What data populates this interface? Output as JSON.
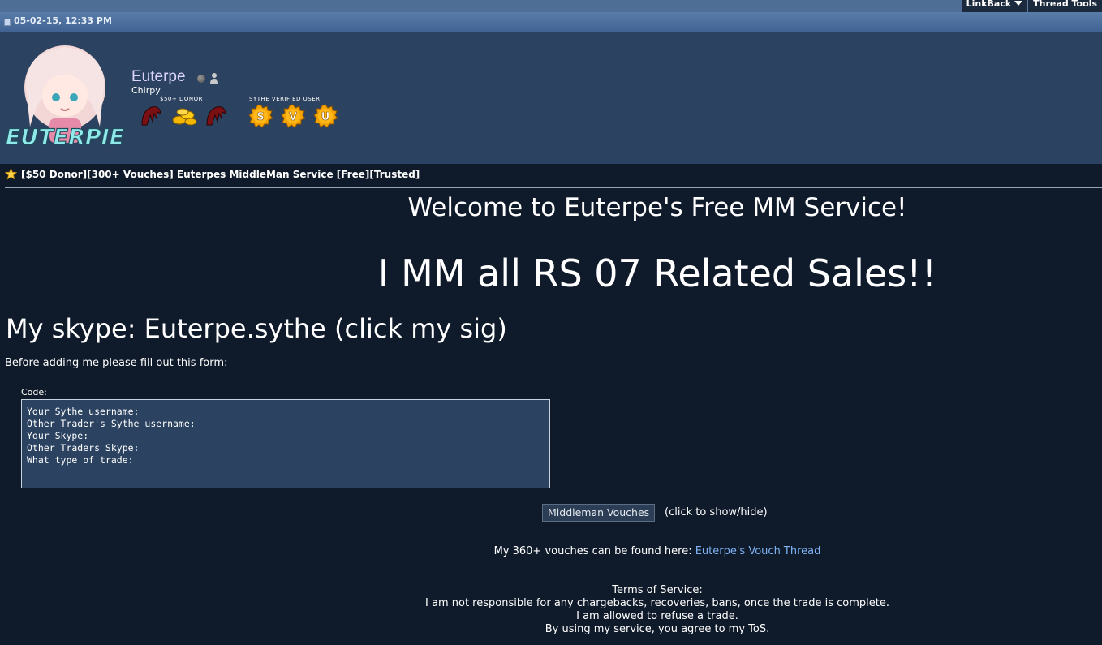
{
  "toolbar": {
    "linkback": "LinkBack",
    "thread_tools": "Thread Tools"
  },
  "post": {
    "date": "05-02-15, 12:33 PM"
  },
  "user": {
    "name": "Euterpe",
    "title": "Chirpy",
    "avatar_text": "EUTERPIE",
    "award_groups": [
      {
        "label": "$50+ DONOR"
      },
      {
        "label": "SYTHE VERIFIED USER",
        "letters": [
          "S",
          "V",
          "U"
        ]
      }
    ]
  },
  "thread": {
    "title": "[$50 Donor][300+ Vouches] Euterpes MiddleMan Service [Free][Trusted]"
  },
  "content": {
    "welcome": "Welcome to Euterpe's Free MM Service!",
    "mm_all": "I MM all RS 07 Related Sales!!",
    "skype": "My skype: Euterpe.sythe (click my sig)",
    "form_intro": "Before adding me please fill out this form:",
    "code_label": "Code:",
    "code_lines": "Your Sythe username:\nOther Trader's Sythe username:\nYour Skype:\nOther Traders Skype:\nWhat type of trade:",
    "vouch_button": "Middleman Vouches",
    "vouch_hint": "(click to show/hide)",
    "vouches_prefix": "My 360+ vouches can be found here:",
    "vouches_link": "Euterpe's Vouch Thread",
    "tos": [
      "Terms of Service:",
      "I am not responsible for any chargebacks, recoveries, bans, once the trade is complete.",
      "I am allowed to refuse a trade.",
      "By using my service, you agree to my ToS."
    ]
  },
  "colors": {
    "background": "#0f1a2a",
    "userinfo_bg": "#2b4260",
    "link": "#7fb3f5",
    "username": "#dcd4ff"
  }
}
